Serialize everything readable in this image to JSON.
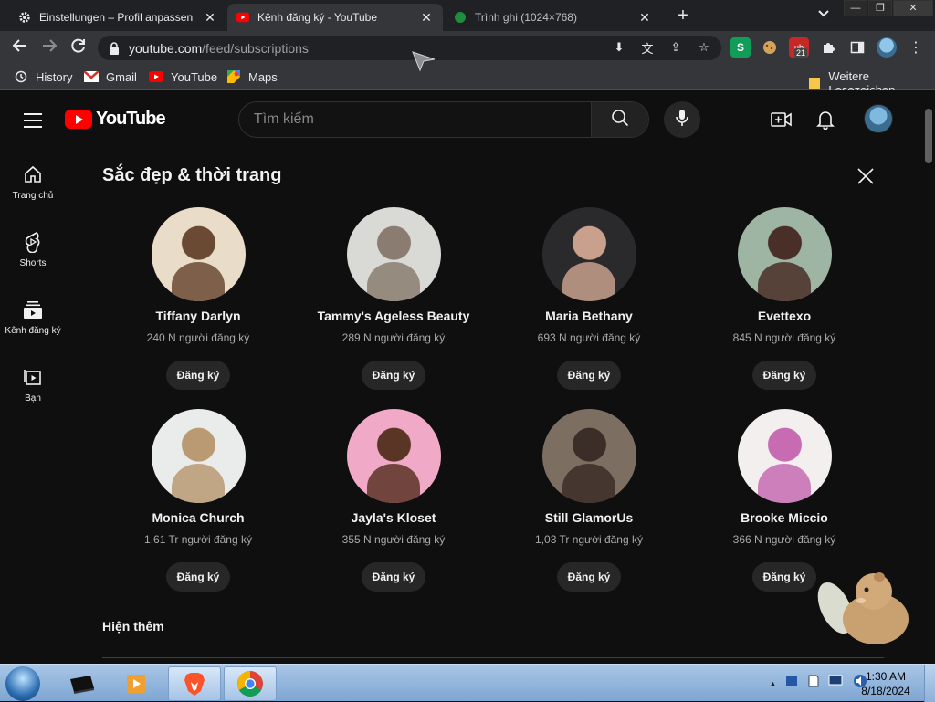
{
  "browser": {
    "tabs": [
      {
        "title": "Einstellungen – Profil anpassen",
        "icon": "gear-icon",
        "active": false
      },
      {
        "title": "Kênh đăng ký - YouTube",
        "icon": "youtube-icon",
        "active": true
      },
      {
        "title": "Trình ghi (1024×768)",
        "icon": "recorder-icon",
        "active": false
      }
    ],
    "new_tab_label": "+",
    "url_host": "youtube.com",
    "url_path": "/feed/subscriptions",
    "extension_badge": "21",
    "bookmarks": [
      {
        "label": "History",
        "icon": "history-icon"
      },
      {
        "label": "Gmail",
        "icon": "gmail-icon"
      },
      {
        "label": "YouTube",
        "icon": "youtube-icon"
      },
      {
        "label": "Maps",
        "icon": "maps-icon"
      }
    ],
    "other_bookmarks": "Weitere Lesezeichen"
  },
  "masthead": {
    "logo_text": "YouTube",
    "search_placeholder": "Tìm kiếm"
  },
  "sidebar": {
    "items": [
      {
        "label": "Trang chủ",
        "icon": "home-icon"
      },
      {
        "label": "Shorts",
        "icon": "shorts-icon"
      },
      {
        "label": "Kênh đăng ký",
        "icon": "subscriptions-icon"
      },
      {
        "label": "Bạn",
        "icon": "you-icon"
      }
    ]
  },
  "section": {
    "title": "Sắc đẹp & thời trang",
    "show_more": "Hiện thêm",
    "channels": [
      {
        "name": "Tiffany Darlyn",
        "subscribers": "240 N người đăng ký",
        "button": "Đăng ký",
        "colors": [
          "#e9dcc9",
          "#6b4a34"
        ]
      },
      {
        "name": "Tammy's Ageless Beauty",
        "subscribers": "289 N người đăng ký",
        "button": "Đăng ký",
        "colors": [
          "#d9d9d6",
          "#8a7c70"
        ]
      },
      {
        "name": "Maria Bethany",
        "subscribers": "693 N người đăng ký",
        "button": "Đăng ký",
        "colors": [
          "#2a2a2c",
          "#c8a08c"
        ]
      },
      {
        "name": "Evettexo",
        "subscribers": "845 N người đăng ký",
        "button": "Đăng ký",
        "colors": [
          "#9fb5a4",
          "#4a2e28"
        ]
      },
      {
        "name": "Monica Church",
        "subscribers": "1,61 Tr người đăng ký",
        "button": "Đăng ký",
        "colors": [
          "#e9ecea",
          "#b99a72"
        ]
      },
      {
        "name": "Jayla's Kloset",
        "subscribers": "355 N người đăng ký",
        "button": "Đăng ký",
        "colors": [
          "#f1a9c8",
          "#5a3425"
        ]
      },
      {
        "name": "Still GlamorUs",
        "subscribers": "1,03 Tr người đăng ký",
        "button": "Đăng ký",
        "colors": [
          "#7d6e62",
          "#3b2e28"
        ]
      },
      {
        "name": "Brooke Miccio",
        "subscribers": "366 N người đăng ký",
        "button": "Đăng ký",
        "colors": [
          "#f2efee",
          "#c76bb3"
        ]
      }
    ]
  },
  "taskbar": {
    "apps": [
      "explorer-icon",
      "media-player-icon",
      "brave-icon",
      "chrome-icon"
    ],
    "time": "1:30 AM",
    "date": "8/18/2024"
  }
}
